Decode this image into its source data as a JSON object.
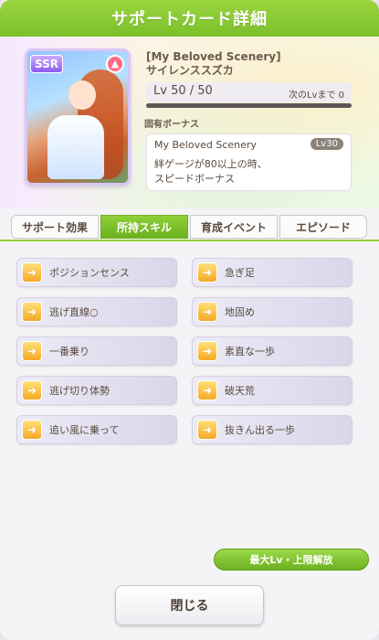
{
  "header": {
    "title": "サポートカード詳細"
  },
  "card": {
    "rarity": "SSR",
    "type_icon": "fire-icon",
    "name_line1": "[My Beloved Scenery]",
    "name_line2": "サイレンススズカ",
    "level_text": "Lv 50 / 50",
    "next_level_text": "次のLvまで  0",
    "level_progress": 1.0
  },
  "unique_bonus": {
    "label": "固有ボーナス",
    "title": "My Beloved Scenery",
    "level_badge": "Lv30",
    "desc_line1": "絆ゲージが80以上の時、",
    "desc_line2": "スピードボーナス"
  },
  "tabs": [
    {
      "label": "サポート効果",
      "active": false
    },
    {
      "label": "所持スキル",
      "active": true
    },
    {
      "label": "育成イベント",
      "active": false
    },
    {
      "label": "エピソード",
      "active": false
    }
  ],
  "skills": [
    {
      "name": "ポジションセンス",
      "icon": "skill-icon"
    },
    {
      "name": "急ぎ足",
      "icon": "skill-icon"
    },
    {
      "name": "逃げ直線○",
      "icon": "skill-icon"
    },
    {
      "name": "地固め",
      "icon": "skill-icon"
    },
    {
      "name": "一番乗り",
      "icon": "skill-icon"
    },
    {
      "name": "素直な一歩",
      "icon": "skill-icon"
    },
    {
      "name": "逃げ切り体勢",
      "icon": "skill-icon"
    },
    {
      "name": "破天荒",
      "icon": "skill-icon"
    },
    {
      "name": "追い風に乗って",
      "icon": "skill-icon"
    },
    {
      "name": "抜きん出る一歩",
      "icon": "skill-icon"
    }
  ],
  "buttons": {
    "unlock": "最大Lv・上限解放",
    "close": "閉じる"
  },
  "colors": {
    "accent_green": "#7bc02a",
    "skill_icon_gold": "#f5a826"
  }
}
